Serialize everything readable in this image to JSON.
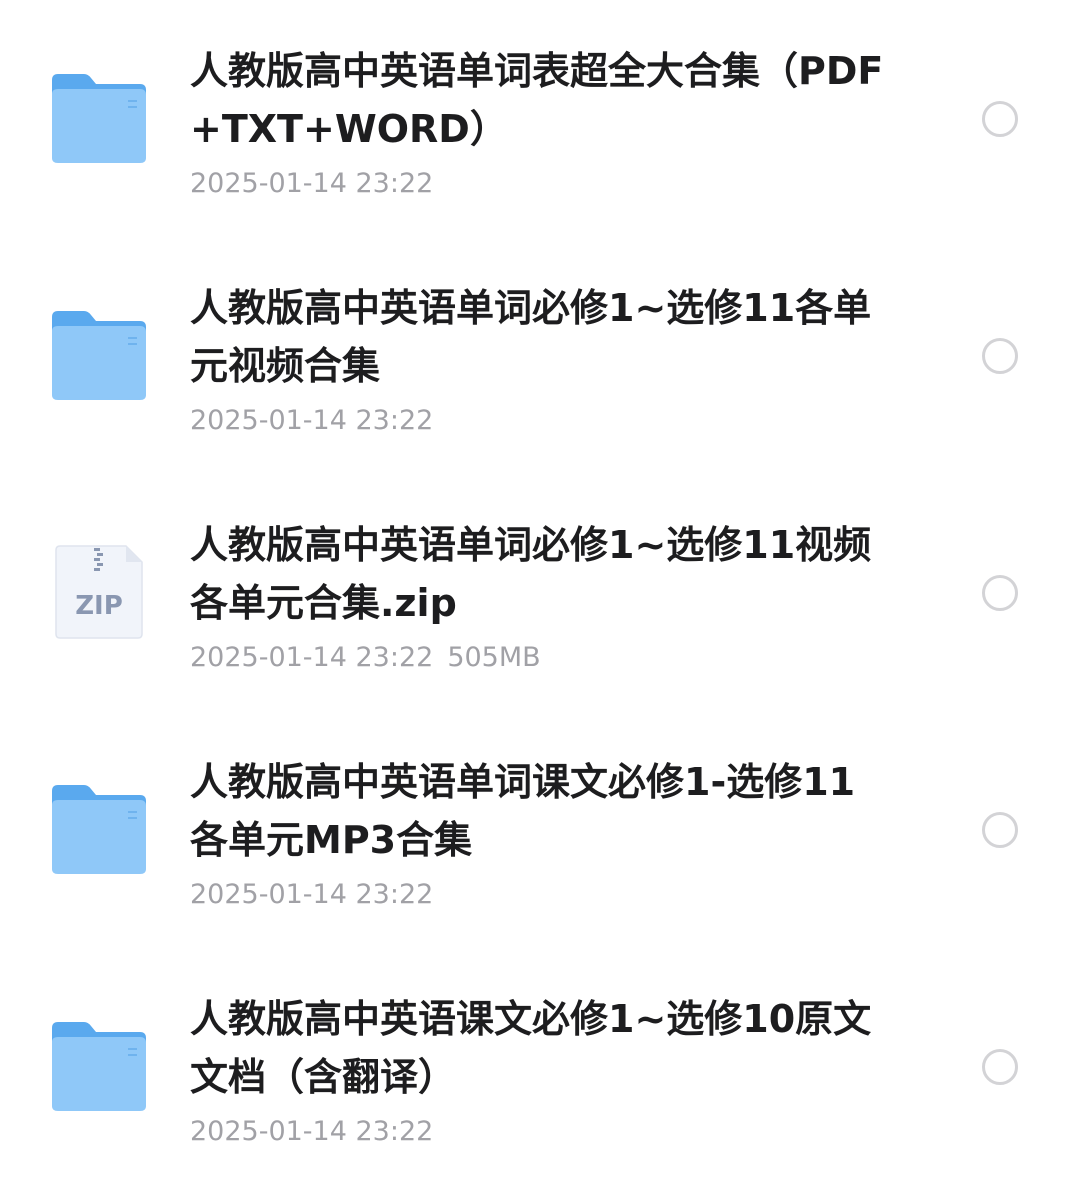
{
  "files": [
    {
      "type": "folder",
      "icon": "folder-icon",
      "name": "人教版高中英语单词表超全大合集（PDF+TXT+WORD）",
      "date": "2025-01-14 23:22",
      "size": ""
    },
    {
      "type": "folder",
      "icon": "folder-icon",
      "name": "人教版高中英语单词必修1~选修11各单元视频合集",
      "date": "2025-01-14 23:22",
      "size": ""
    },
    {
      "type": "zip",
      "icon": "zip-file-icon",
      "icon_label": "ZIP",
      "name": "人教版高中英语单词必修1~选修11视频各单元合集.zip",
      "date": "2025-01-14 23:22",
      "size": "505MB"
    },
    {
      "type": "folder",
      "icon": "folder-icon",
      "name": "人教版高中英语单词课文必修1-选修11各单元MP3合集",
      "date": "2025-01-14 23:22",
      "size": ""
    },
    {
      "type": "folder",
      "icon": "folder-icon",
      "name": "人教版高中英语课文必修1~选修10原文文档（含翻译）",
      "date": "2025-01-14 23:22",
      "size": ""
    }
  ],
  "colors": {
    "folder_light": "#8fc8f8",
    "folder_dark": "#5aa9ee",
    "zip_bg": "#f1f4fa",
    "zip_label": "#8a97b1",
    "name_text": "#1d1d1f",
    "meta_text": "#a1a1a6",
    "radio_border": "#d3d3d6"
  }
}
